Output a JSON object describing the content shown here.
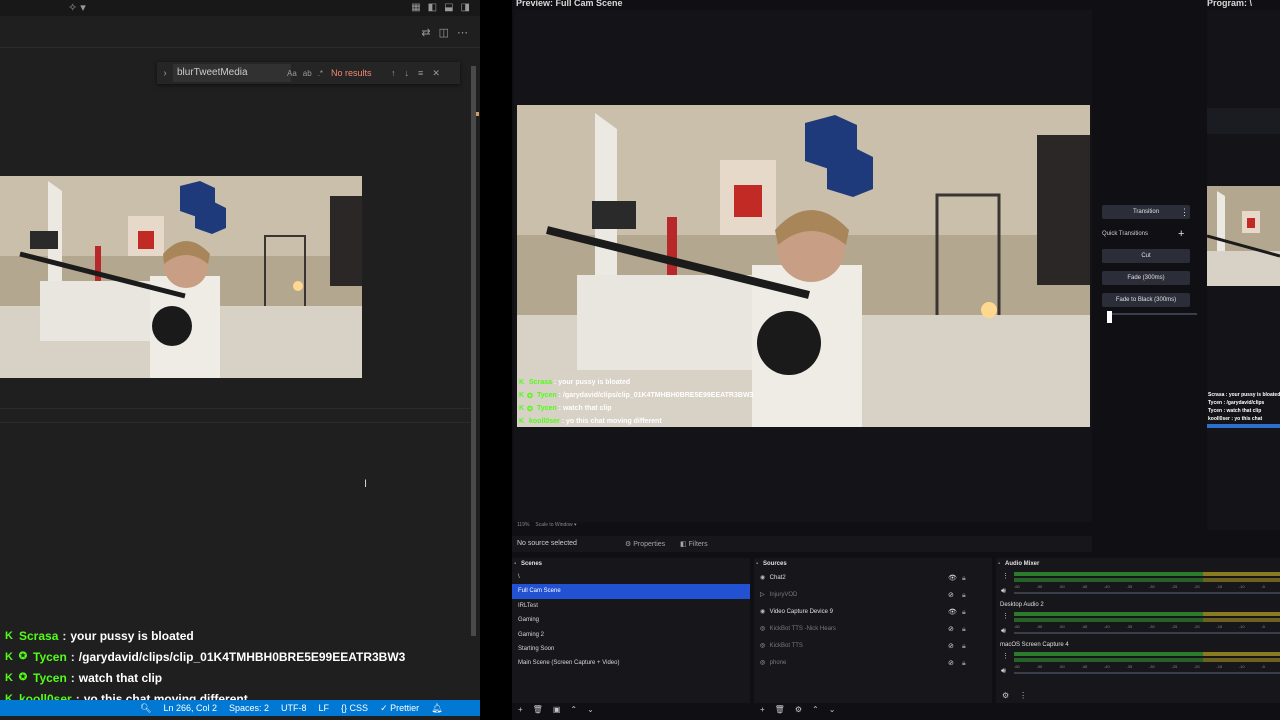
{
  "editor": {
    "find": {
      "query": "blurTweetMedia",
      "opt_case": "Aa",
      "opt_word": "ab",
      "opt_regex": ".*",
      "result": "No results"
    },
    "chat": [
      {
        "user": "Scrasa",
        "message": "your pussy is bloated",
        "badges": 1
      },
      {
        "user": "Tycen",
        "message": "/garydavid/clips/clip_01K4TMHBH0BRE5E99EEATR3BW3",
        "badges": 2
      },
      {
        "user": "Tycen",
        "message": "watch that clip",
        "badges": 2
      },
      {
        "user": "kooll0ser",
        "message": "yo this chat moving different",
        "badges": 1
      }
    ],
    "status": {
      "position": "Ln 266, Col 2",
      "spaces": "Spaces: 2",
      "encoding": "UTF-8",
      "eol": "LF",
      "language": "CSS",
      "formatter": "Prettier"
    }
  },
  "obs": {
    "preview_title": "Preview: Full Cam Scene",
    "program_title": "Program: \\",
    "overlay_chat": [
      {
        "user": "Scrasa",
        "message": "your pussy is bloated"
      },
      {
        "user": "Tycen",
        "message": "/garydavid/clips/clip_01K4TMHBH0BRE5E99EEATR3BW3"
      },
      {
        "user": "Tycen",
        "message": "watch that clip"
      },
      {
        "user": "kooll0ser",
        "message": "yo this chat moving different"
      }
    ],
    "program_chat": [
      "Scrasa : your pussy is bloated",
      "Tycen : /garydavid/clips",
      "Tycen : watch that clip",
      "kooll0ser : yo this chat"
    ],
    "scale": {
      "percent": "119%",
      "mode": "Scale to Window"
    },
    "no_source": "No source selected",
    "properties_label": "Properties",
    "filters_label": "Filters",
    "transitions": {
      "transition_label": "Transition",
      "quick_label": "Quick Transitions",
      "cut": "Cut",
      "fade": "Fade (300ms)",
      "fade_black": "Fade to Black (300ms)"
    },
    "scenes": {
      "title": "Scenes",
      "items": [
        "\\",
        "Full Cam Scene",
        "IRLTest",
        "Gaming",
        "Gaming 2",
        "Starting Soon",
        "Main Scene (Screen Capture + Video)"
      ],
      "selected": "Full Cam Scene"
    },
    "sources": {
      "title": "Sources",
      "items": [
        {
          "name": "Chat2",
          "visible": true
        },
        {
          "name": "InjuryVOD",
          "visible": false
        },
        {
          "name": "Video Capture Device 9",
          "visible": true
        },
        {
          "name": "KickBot TTS -Nick Hears",
          "visible": false
        },
        {
          "name": "KickBot TTS",
          "visible": false
        },
        {
          "name": "phone",
          "visible": false
        }
      ]
    },
    "mixer": {
      "title": "Audio Mixer",
      "channels": [
        "",
        "Desktop Audio 2",
        "macOS Screen Capture 4"
      ],
      "ticks": [
        "-60",
        "-55",
        "-50",
        "-45",
        "-40",
        "-35",
        "-30",
        "-25",
        "-20",
        "-15",
        "-10",
        "-5",
        "0"
      ]
    }
  }
}
